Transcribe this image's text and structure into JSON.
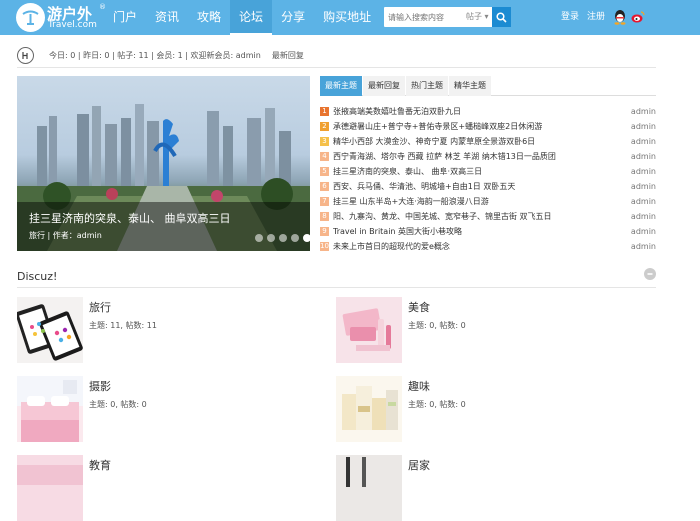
{
  "header": {
    "logo_text": "游户外",
    "logo_reg": "®",
    "logo_sub": "Travel.com",
    "nav": [
      {
        "label": "门户"
      },
      {
        "label": "资讯"
      },
      {
        "label": "攻略"
      },
      {
        "label": "论坛"
      },
      {
        "label": "分享"
      },
      {
        "label": "购买地址"
      }
    ],
    "active_nav": "论坛",
    "search_placeholder": "请输入搜索内容",
    "search_category": "帖子",
    "login": "登录",
    "register": "注册",
    "brand_color": "#5cb3e6"
  },
  "stats": {
    "text": "今日: 0 | 昨日: 0 | 帖子: 11 | 会员: 1 | 欢迎新会员: admin",
    "latest_reply": "最新回复"
  },
  "slider": {
    "caption_title": "挂三星济南的突泉、泰山、 曲阜双高三日",
    "caption_meta": "旅行 | 作者：admin",
    "dot_count": 5,
    "active_dot": 5
  },
  "tabs": [
    "最新主题",
    "最新回复",
    "热门主题",
    "精华主题"
  ],
  "threads": [
    {
      "num": "1",
      "title": "张掖高端美数嬉吐鲁番无泊双卧九日",
      "author": "admin"
    },
    {
      "num": "2",
      "title": "承德避暑山庄+普宁寺+普佑寺景区+蟠槌峰双座2日休闲游",
      "author": "admin"
    },
    {
      "num": "3",
      "title": "精华小西部 大漠金沙、神奇宁夏 内蒙草原全景游双卧6日",
      "author": "admin"
    },
    {
      "num": "4",
      "title": "西宁青海湖、塔尔寺 西藏 拉萨 林芝 羊湖 纳木错13日一品质团",
      "author": "admin"
    },
    {
      "num": "5",
      "title": "挂三星济南的突泉、泰山、 曲阜·双高三日",
      "author": "admin"
    },
    {
      "num": "6",
      "title": "西安、兵马俑、华清池、明城墙+自由1日 双卧五天",
      "author": "admin"
    },
    {
      "num": "7",
      "title": "挂三星 山东半岛+大连·海韵一船浪漫八日游",
      "author": "admin"
    },
    {
      "num": "8",
      "title": "阳、九寨沟、黄龙、中国羌城、宽窄巷子、锦里古街 双飞五日",
      "author": "admin"
    },
    {
      "num": "9",
      "title": "Travel in Britain 英国大街小巷攻略",
      "author": "admin"
    },
    {
      "num": "10",
      "title": "未来上市首日的超现代的爱e概念",
      "author": "admin"
    }
  ],
  "section": {
    "title": "Discuz!"
  },
  "forums": [
    {
      "name": "旅行",
      "stats": "主题: 11, 帖数: 11"
    },
    {
      "name": "美食",
      "stats": "主题: 0, 帖数: 0"
    },
    {
      "name": "摄影",
      "stats": "主题: 0, 帖数: 0"
    },
    {
      "name": "趣味",
      "stats": "主题: 0, 帖数: 0"
    },
    {
      "name": "教育",
      "stats": ""
    },
    {
      "name": "居家",
      "stats": ""
    }
  ]
}
